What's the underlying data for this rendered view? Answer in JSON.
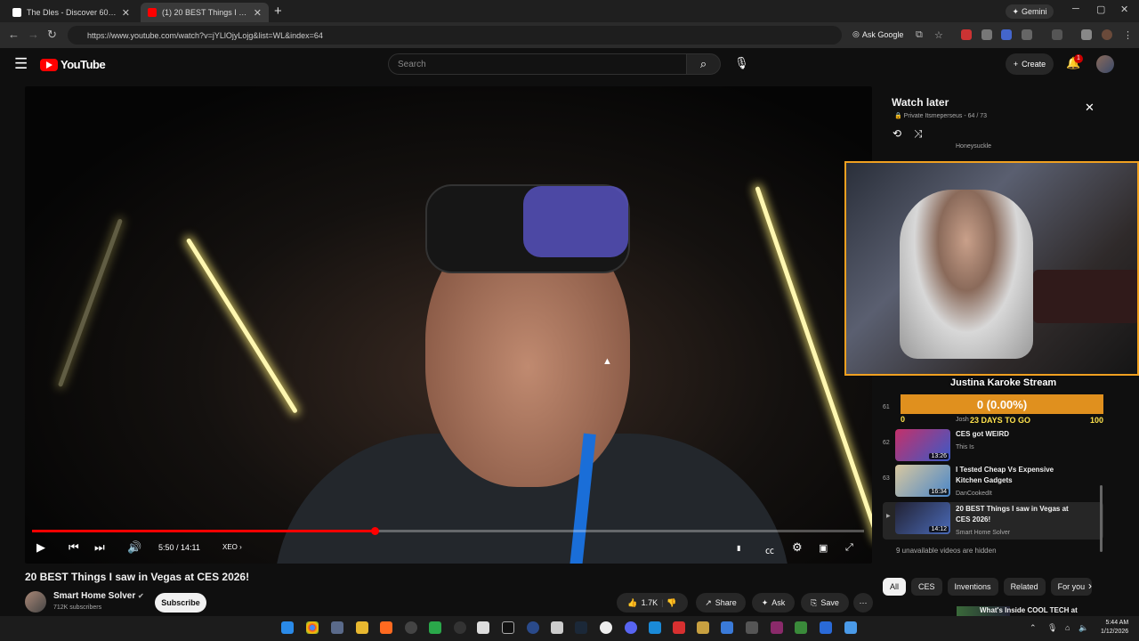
{
  "browser": {
    "tabs": [
      {
        "label": "The Dles - Discover 600+ Free D",
        "active": false
      },
      {
        "label": "(1) 20 BEST Things I saw in Veg",
        "active": true
      }
    ],
    "gemini_label": "Gemini",
    "url": "https://www.youtube.com/watch?v=jYLlOjyLojg&list=WL&index=64",
    "ask_google": "Ask Google"
  },
  "youtube": {
    "logo_text": "YouTube",
    "search_placeholder": "Search",
    "create_label": "Create",
    "notification_count": "1"
  },
  "player": {
    "time": "5:50 / 14:11",
    "chapter": "XEO",
    "progress_fraction": 0.412
  },
  "video": {
    "title": "20 BEST Things I saw in Vegas at CES 2026!",
    "channel": "Smart Home Solver",
    "subscribers": "712K subscribers",
    "subscribe_label": "Subscribe",
    "likes": "1.7K",
    "share_label": "Share",
    "ask_label": "Ask",
    "save_label": "Save"
  },
  "playlist": {
    "title": "Watch later",
    "subtitle": "Private  Itsmeperseus - 64 / 73",
    "top_channel": "Honeysuckle",
    "items": [
      {
        "num": "61",
        "title": "",
        "channel": "Josh",
        "duration": ""
      },
      {
        "num": "62",
        "title": "CES got WEIRD",
        "channel": "This Is",
        "duration": "13:26"
      },
      {
        "num": "63",
        "title": "I Tested Cheap Vs Expensive Kitchen Gadgets",
        "channel": "DanCookedIt",
        "duration": "16:34"
      },
      {
        "num": "",
        "title": "20 BEST Things I saw in Vegas at CES 2026!",
        "channel": "Smart Home Solver",
        "duration": "14:12"
      }
    ],
    "hidden_note": "9 unavailable videos are hidden"
  },
  "stream_overlay": {
    "goal_title": "Justina Karoke Stream",
    "goal_value": "0 (0.00%)",
    "goal_min": "0",
    "goal_days": "23 DAYS TO GO",
    "goal_max": "100"
  },
  "chips": [
    "All",
    "CES",
    "Inventions",
    "Related",
    "For you"
  ],
  "next_video_title": "What's Inside COOL TECH at",
  "taskbar": {
    "time": "5:44 AM",
    "date": "1/12/2026"
  },
  "colors": {
    "accent": "#ff0000",
    "goal_bar": "#e0901e",
    "overlay_border": "#f0a020"
  }
}
